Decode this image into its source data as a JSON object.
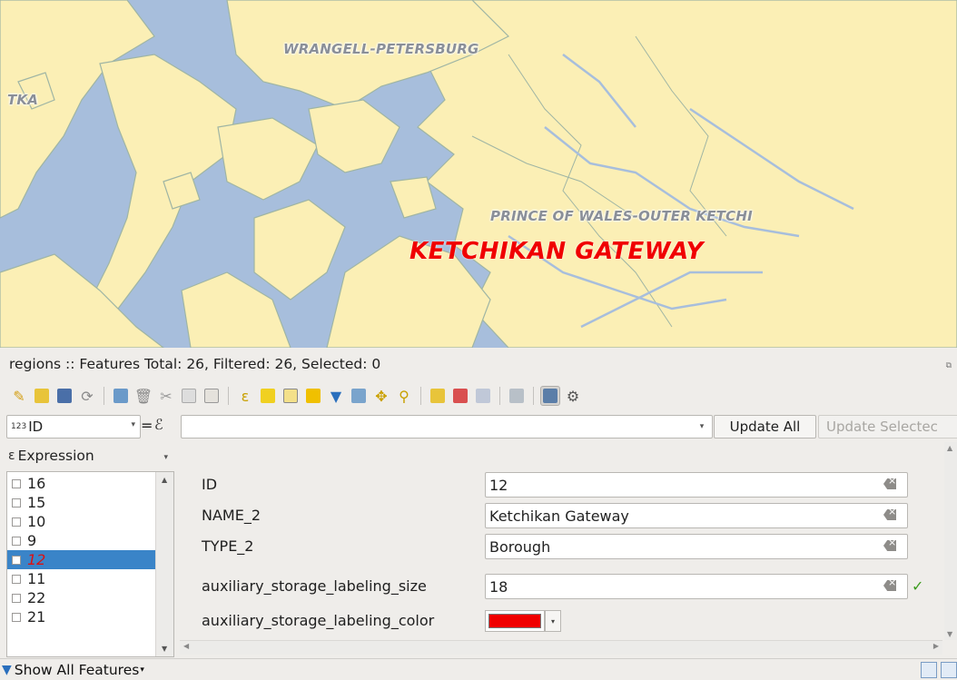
{
  "map": {
    "labels": {
      "wrangell": "WRANGELL-PETERSBURG",
      "sitka": "TKA",
      "prince": "PRINCE OF WALES-OUTER KETCHI",
      "ketchikan": "KETCHIKAN GATEWAY"
    },
    "colors": {
      "water": "#a7bedc",
      "land": "#fbefb5",
      "border": "#9fb5a4",
      "highlight_label": "#f00000"
    }
  },
  "status": {
    "text": "regions :: Features Total: 26, Filtered: 26, Selected: 0"
  },
  "filter_bar": {
    "field_prefix": "123",
    "field": "ID",
    "operator": "=",
    "search_value": "",
    "update_all": "Update All",
    "update_selected": "Update Selectec"
  },
  "left_panel": {
    "expression_button": "Expression",
    "items": [
      "16",
      "15",
      "10",
      "9",
      "12",
      "11",
      "22",
      "21"
    ],
    "selected": "12"
  },
  "form": {
    "fields": [
      {
        "label": "ID",
        "value": "12"
      },
      {
        "label": "NAME_2",
        "value": "Ketchikan Gateway"
      },
      {
        "label": "TYPE_2",
        "value": "Borough"
      },
      {
        "label": "auxiliary_storage_labeling_size",
        "value": "18"
      },
      {
        "label": "auxiliary_storage_labeling_color",
        "value": "#f00000"
      }
    ]
  },
  "bottom": {
    "show_all": "Show All Features"
  }
}
